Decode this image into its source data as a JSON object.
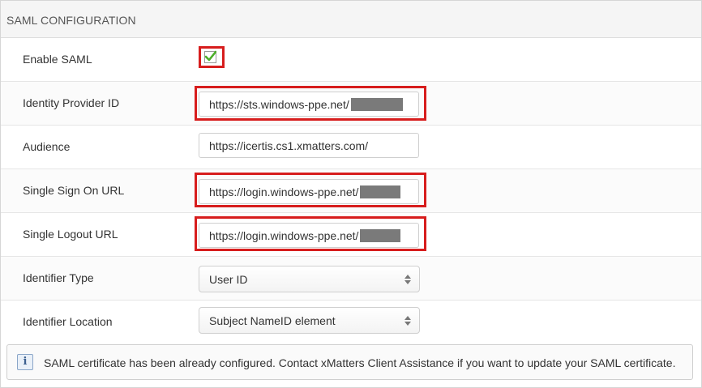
{
  "section": {
    "title": "SAML CONFIGURATION"
  },
  "fields": {
    "enable_saml": {
      "label": "Enable SAML",
      "checked": true
    },
    "identity_provider_id": {
      "label": "Identity Provider ID",
      "value": "https://sts.windows-ppe.net/"
    },
    "audience": {
      "label": "Audience",
      "value": "https://icertis.cs1.xmatters.com/"
    },
    "single_sign_on_url": {
      "label": "Single Sign On URL",
      "value": "https://login.windows-ppe.net/"
    },
    "single_logout_url": {
      "label": "Single Logout URL",
      "value": "https://login.windows-ppe.net/"
    },
    "identifier_type": {
      "label": "Identifier Type",
      "value": "User ID"
    },
    "identifier_location": {
      "label": "Identifier Location",
      "value": "Subject NameID element"
    }
  },
  "info": {
    "icon": "info-icon",
    "text": "SAML certificate has been already configured. Contact xMatters Client Assistance if you want to update your SAML certificate."
  },
  "colors": {
    "highlight": "#d71d1d",
    "checkmark": "#4caf2a",
    "redaction": "#7a7a7a"
  }
}
